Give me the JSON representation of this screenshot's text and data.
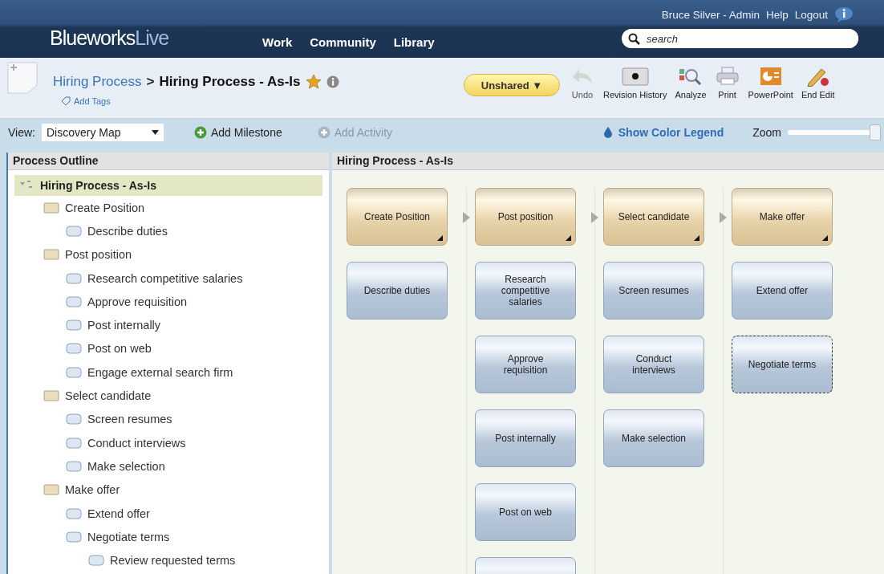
{
  "header": {
    "logo_main": "Blueworks",
    "logo_accent": "Live",
    "user": "Bruce Silver - Admin",
    "links": [
      "Help",
      "Logout"
    ],
    "nav": [
      "Work",
      "Community",
      "Library"
    ],
    "search": {
      "placeholder": "search"
    }
  },
  "toolbar": {
    "breadcrumb_parent": "Hiring Process",
    "separator": ">",
    "title": "Hiring Process - As-Is",
    "starred": true,
    "add_tags": "Add Tags",
    "share": "Unshared ▼",
    "tools": [
      {
        "kind": "undo",
        "label": "Undo",
        "disabled": true
      },
      {
        "kind": "history",
        "label": "Revision History",
        "disabled": false
      },
      {
        "kind": "analyze",
        "label": "Analyze",
        "disabled": false
      },
      {
        "kind": "print",
        "label": "Print",
        "disabled": false
      },
      {
        "kind": "powerpoint",
        "label": "PowerPoint",
        "disabled": false
      },
      {
        "kind": "endedit",
        "label": "End Edit",
        "disabled": false
      }
    ]
  },
  "viewbar": {
    "view_label": "View:",
    "view_value": "Discovery Map",
    "add_milestone": {
      "label": "Add Milestone",
      "disabled": false
    },
    "add_activity": {
      "label": "Add Activity",
      "disabled": true
    },
    "legend": "Show Color Legend",
    "zoom_label": "Zoom",
    "zoom": {
      "level": 1
    }
  },
  "outline": {
    "title": "Process Outline",
    "root": {
      "label": "Hiring Process - As-Is",
      "selected": true,
      "expanded": true,
      "children": [
        {
          "label": "Create Position",
          "kind": "milestone",
          "children": [
            {
              "label": "Describe duties",
              "kind": "activity"
            }
          ]
        },
        {
          "label": "Post position",
          "kind": "milestone",
          "children": [
            {
              "label": "Research competitive salaries",
              "kind": "activity"
            },
            {
              "label": "Approve requisition",
              "kind": "activity"
            },
            {
              "label": "Post internally",
              "kind": "activity"
            },
            {
              "label": "Post on web",
              "kind": "activity"
            },
            {
              "label": "Engage external search firm",
              "kind": "activity"
            }
          ]
        },
        {
          "label": "Select candidate",
          "kind": "milestone",
          "children": [
            {
              "label": "Screen resumes",
              "kind": "activity"
            },
            {
              "label": "Conduct interviews",
              "kind": "activity"
            },
            {
              "label": "Make selection",
              "kind": "activity"
            }
          ]
        },
        {
          "label": "Make offer",
          "kind": "milestone",
          "children": [
            {
              "label": "Extend offer",
              "kind": "activity"
            },
            {
              "label": "Negotiate terms",
              "kind": "activity",
              "children": [
                {
                  "label": "Review requested terms",
                  "kind": "activity"
                }
              ]
            }
          ]
        }
      ]
    }
  },
  "map": {
    "title": "Hiring Process - As-Is",
    "columns": [
      {
        "milestone": "Create Position",
        "activities": [
          {
            "kind": "card",
            "label": "Describe duties",
            "has_subprocess": false
          }
        ]
      },
      {
        "milestone": "Post position",
        "activities": [
          {
            "kind": "card",
            "label": "Research competitive salaries",
            "has_subprocess": false
          },
          {
            "kind": "card",
            "label": "Approve requisition",
            "has_subprocess": false
          },
          {
            "kind": "card",
            "label": "Post internally",
            "has_subprocess": false
          },
          {
            "kind": "card",
            "label": "Post on web",
            "has_subprocess": false
          },
          {
            "kind": "stub"
          }
        ]
      },
      {
        "milestone": "Select candidate",
        "activities": [
          {
            "kind": "card",
            "label": "Screen resumes",
            "has_subprocess": false
          },
          {
            "kind": "card",
            "label": "Conduct interviews",
            "has_subprocess": false
          },
          {
            "kind": "card",
            "label": "Make selection",
            "has_subprocess": false
          }
        ]
      },
      {
        "milestone": "Make offer",
        "activities": [
          {
            "kind": "card",
            "label": "Extend offer",
            "has_subprocess": false
          },
          {
            "kind": "card",
            "label": "Negotiate terms",
            "has_subprocess": true
          }
        ]
      }
    ]
  }
}
